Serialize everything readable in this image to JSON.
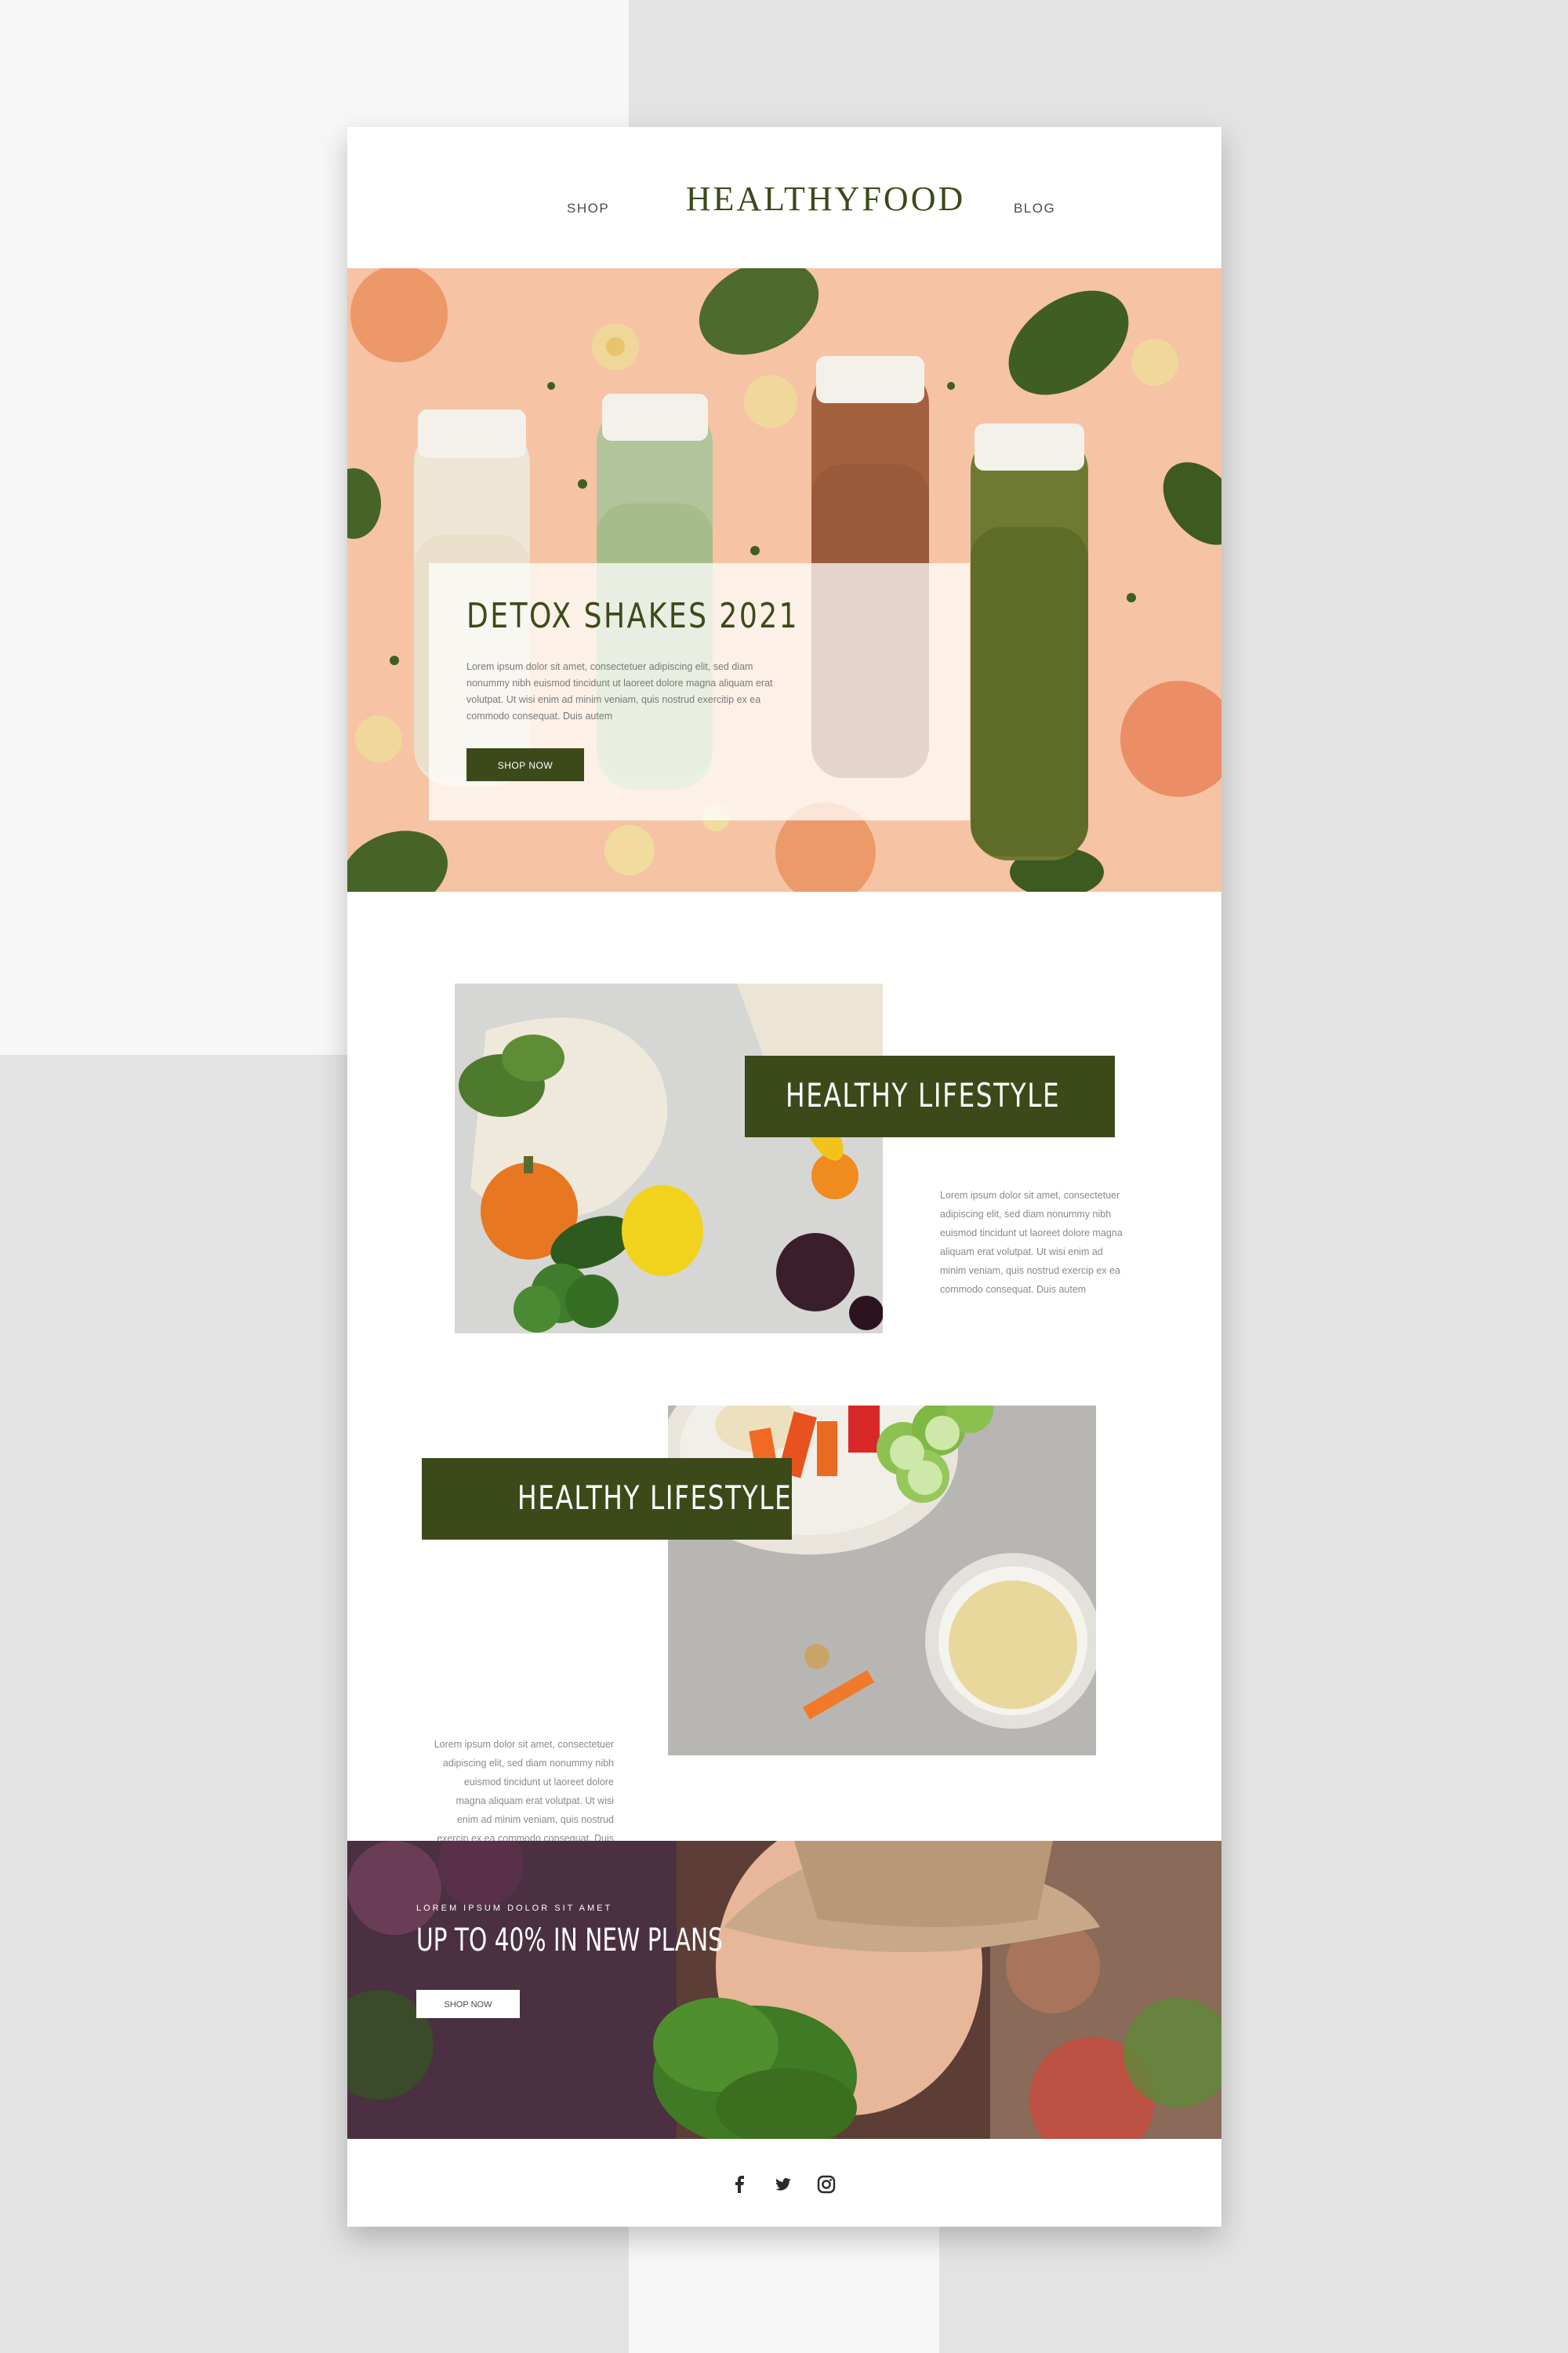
{
  "header": {
    "nav_left": "SHOP",
    "brand": "HEALTHYFOOD",
    "nav_right": "BLOG"
  },
  "hero": {
    "title": "DETOX SHAKES 2021",
    "body": "Lorem ipsum dolor sit amet, consectetuer adipiscing elit, sed diam nonummy nibh euismod tincidunt ut laoreet dolore magna aliquam erat volutpat. Ut wisi enim ad minim veniam, quis nostrud exerci​tip ex ea commodo consequat. Duis autem",
    "button": "SHOP NOW"
  },
  "feature1": {
    "title": "HEALTHY LIFESTYLE",
    "body": "Lorem ipsum dolor sit amet, consectetuer adipiscing elit, sed diam nonummy nibh euismod tincidunt ut laoreet dolore magna aliquam erat volutpat. Ut wisi enim ad minim veniam, quis nostrud exercip ex ea commodo consequat. Duis autem"
  },
  "feature2": {
    "title": "HEALTHY LIFESTYLE",
    "body": "Lorem ipsum dolor sit amet, consectetuer adipiscing elit, sed diam nonummy nibh euismod tincidunt ut laoreet dolore magna aliquam erat volutpat. Ut wisi enim ad minim veniam, quis nostrud exercip ex ea commodo consequat. Duis autem"
  },
  "promo": {
    "kicker": "LOREM IPSUM DOLOR SIT AMET",
    "title": "UP TO 40% IN NEW PLANS",
    "button": "SHOP NOW"
  },
  "footer": {
    "socials": [
      "facebook-icon",
      "twitter-icon",
      "instagram-icon"
    ]
  },
  "colors": {
    "brand_green": "#3c4a1a",
    "hero_peach": "#f6c3a4"
  }
}
